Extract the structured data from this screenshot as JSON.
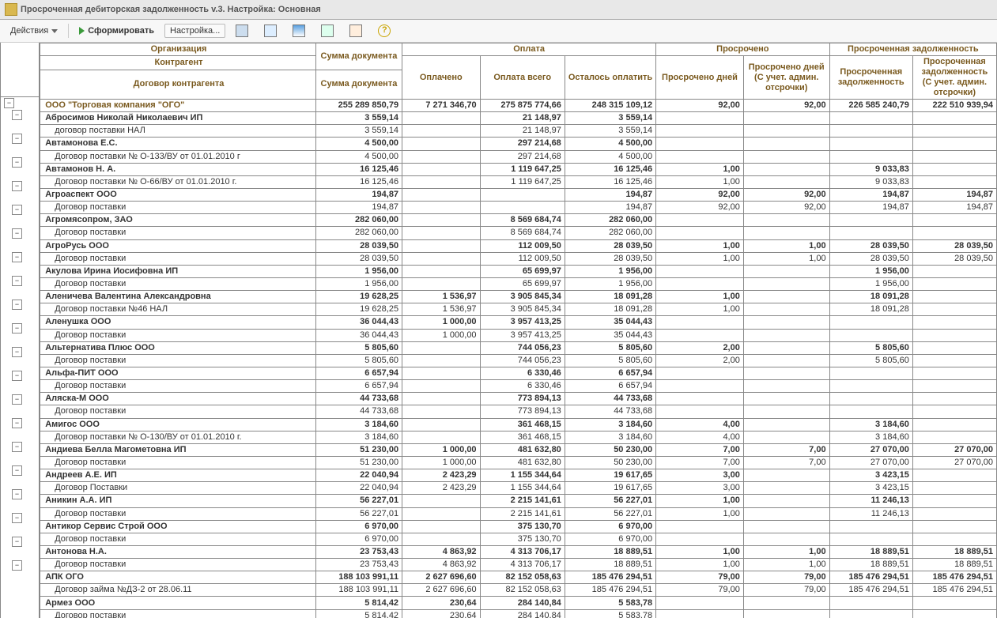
{
  "window_title": "Просроченная дебиторская задолженность v.3. Настройка: Основная",
  "toolbar": {
    "actions": "Действия",
    "form": "Сформировать",
    "settings": "Настройка..."
  },
  "header": {
    "org": "Организация",
    "kagent": "Контрагент",
    "dogovor": "Договор контрагента",
    "sum_doc": "Сумма документа",
    "oplata": "Оплата",
    "oplacheno": "Оплачено",
    "oplata_vsego": "Оплата всего",
    "ost_oplat": "Осталось оплатить",
    "prosr": "Просрочено",
    "prosr_dnei": "Просрочено дней",
    "prosr_dnei_adm": "Просрочено дней (С учет. админ. отсрочки)",
    "zadolz": "Просроченная задолженность",
    "z1": "Просроченная задолженность",
    "z2": "Просроченная задолженность (С учет. админ. отсрочки)"
  },
  "rows": [
    {
      "lvl": 0,
      "exp": "-",
      "name": "ООО \"Торговая компания \"ОГО\"",
      "c": [
        "255 289 850,79",
        "7 271 346,70",
        "275 875 774,66",
        "248 315 109,12",
        "92,00",
        "92,00",
        "226 585 240,79",
        "222 510 939,94"
      ]
    },
    {
      "lvl": 1,
      "exp": "-",
      "name": "Абросимов Николай Николаевич ИП",
      "c": [
        "3 559,14",
        "",
        "21 148,97",
        "3 559,14",
        "",
        "",
        "",
        ""
      ]
    },
    {
      "lvl": 2,
      "name": "договор поставки НАЛ",
      "c": [
        "3 559,14",
        "",
        "21 148,97",
        "3 559,14",
        "",
        "",
        "",
        ""
      ]
    },
    {
      "lvl": 1,
      "exp": "-",
      "name": "Автамонова Е.С.",
      "c": [
        "4 500,00",
        "",
        "297 214,68",
        "4 500,00",
        "",
        "",
        "",
        ""
      ]
    },
    {
      "lvl": 2,
      "name": "Договор поставки № О-133/ВУ от 01.01.2010 г",
      "c": [
        "4 500,00",
        "",
        "297 214,68",
        "4 500,00",
        "",
        "",
        "",
        ""
      ]
    },
    {
      "lvl": 1,
      "exp": "-",
      "name": "Автамонов Н. А.",
      "c": [
        "16 125,46",
        "",
        "1 119 647,25",
        "16 125,46",
        "1,00",
        "",
        "9 033,83",
        ""
      ]
    },
    {
      "lvl": 2,
      "name": "Договор поставки № О-66/ВУ от 01.01.2010 г.",
      "c": [
        "16 125,46",
        "",
        "1 119 647,25",
        "16 125,46",
        "1,00",
        "",
        "9 033,83",
        ""
      ]
    },
    {
      "lvl": 1,
      "exp": "-",
      "name": "Агроаспект ООО",
      "c": [
        "194,87",
        "",
        "",
        "194,87",
        "92,00",
        "92,00",
        "194,87",
        "194,87"
      ]
    },
    {
      "lvl": 2,
      "name": "Договор поставки",
      "c": [
        "194,87",
        "",
        "",
        "194,87",
        "92,00",
        "92,00",
        "194,87",
        "194,87"
      ]
    },
    {
      "lvl": 1,
      "exp": "-",
      "name": "Агромясопром, ЗАО",
      "c": [
        "282 060,00",
        "",
        "8 569 684,74",
        "282 060,00",
        "",
        "",
        "",
        ""
      ]
    },
    {
      "lvl": 2,
      "name": "Договор поставки",
      "c": [
        "282 060,00",
        "",
        "8 569 684,74",
        "282 060,00",
        "",
        "",
        "",
        ""
      ]
    },
    {
      "lvl": 1,
      "exp": "-",
      "name": "АгроРусь ООО",
      "c": [
        "28 039,50",
        "",
        "112 009,50",
        "28 039,50",
        "1,00",
        "1,00",
        "28 039,50",
        "28 039,50"
      ]
    },
    {
      "lvl": 2,
      "name": "Договор поставки",
      "c": [
        "28 039,50",
        "",
        "112 009,50",
        "28 039,50",
        "1,00",
        "1,00",
        "28 039,50",
        "28 039,50"
      ]
    },
    {
      "lvl": 1,
      "exp": "-",
      "name": "Акулова Ирина Иосифовна ИП",
      "c": [
        "1 956,00",
        "",
        "65 699,97",
        "1 956,00",
        "",
        "",
        "1 956,00",
        ""
      ]
    },
    {
      "lvl": 2,
      "name": "Договор поставки",
      "c": [
        "1 956,00",
        "",
        "65 699,97",
        "1 956,00",
        "",
        "",
        "1 956,00",
        ""
      ]
    },
    {
      "lvl": 1,
      "exp": "-",
      "name": "Аленичева Валентина Александровна",
      "c": [
        "19 628,25",
        "1 536,97",
        "3 905 845,34",
        "18 091,28",
        "1,00",
        "",
        "18 091,28",
        ""
      ]
    },
    {
      "lvl": 2,
      "name": "Договор поставки №46 НАЛ",
      "c": [
        "19 628,25",
        "1 536,97",
        "3 905 845,34",
        "18 091,28",
        "1,00",
        "",
        "18 091,28",
        ""
      ]
    },
    {
      "lvl": 1,
      "exp": "-",
      "name": "Аленушка ООО",
      "c": [
        "36 044,43",
        "1 000,00",
        "3 957 413,25",
        "35 044,43",
        "",
        "",
        "",
        ""
      ]
    },
    {
      "lvl": 2,
      "name": "Договор поставки",
      "c": [
        "36 044,43",
        "1 000,00",
        "3 957 413,25",
        "35 044,43",
        "",
        "",
        "",
        ""
      ]
    },
    {
      "lvl": 1,
      "exp": "-",
      "name": "Альтернатива Плюс ООО",
      "c": [
        "5 805,60",
        "",
        "744 056,23",
        "5 805,60",
        "2,00",
        "",
        "5 805,60",
        ""
      ]
    },
    {
      "lvl": 2,
      "name": "Договор поставки",
      "c": [
        "5 805,60",
        "",
        "744 056,23",
        "5 805,60",
        "2,00",
        "",
        "5 805,60",
        ""
      ]
    },
    {
      "lvl": 1,
      "exp": "-",
      "name": "Альфа-ПИТ ООО",
      "c": [
        "6 657,94",
        "",
        "6 330,46",
        "6 657,94",
        "",
        "",
        "",
        ""
      ]
    },
    {
      "lvl": 2,
      "name": "Договор поставки",
      "c": [
        "6 657,94",
        "",
        "6 330,46",
        "6 657,94",
        "",
        "",
        "",
        ""
      ]
    },
    {
      "lvl": 1,
      "exp": "-",
      "name": "Аляска-М ООО",
      "c": [
        "44 733,68",
        "",
        "773 894,13",
        "44 733,68",
        "",
        "",
        "",
        ""
      ]
    },
    {
      "lvl": 2,
      "name": "Договор поставки",
      "c": [
        "44 733,68",
        "",
        "773 894,13",
        "44 733,68",
        "",
        "",
        "",
        ""
      ]
    },
    {
      "lvl": 1,
      "exp": "-",
      "name": "Амигос ООО",
      "c": [
        "3 184,60",
        "",
        "361 468,15",
        "3 184,60",
        "4,00",
        "",
        "3 184,60",
        ""
      ]
    },
    {
      "lvl": 2,
      "name": "Договор поставки № О-130/ВУ от 01.01.2010 г.",
      "c": [
        "3 184,60",
        "",
        "361 468,15",
        "3 184,60",
        "4,00",
        "",
        "3 184,60",
        ""
      ]
    },
    {
      "lvl": 1,
      "exp": "-",
      "name": "Андиева Белла Магометовна ИП",
      "c": [
        "51 230,00",
        "1 000,00",
        "481 632,80",
        "50 230,00",
        "7,00",
        "7,00",
        "27 070,00",
        "27 070,00"
      ]
    },
    {
      "lvl": 2,
      "name": "Договор поставки",
      "c": [
        "51 230,00",
        "1 000,00",
        "481 632,80",
        "50 230,00",
        "7,00",
        "7,00",
        "27 070,00",
        "27 070,00"
      ]
    },
    {
      "lvl": 1,
      "exp": "-",
      "name": "Андреев А.Е. ИП",
      "c": [
        "22 040,94",
        "2 423,29",
        "1 155 344,64",
        "19 617,65",
        "3,00",
        "",
        "3 423,15",
        ""
      ]
    },
    {
      "lvl": 2,
      "name": "Договор Поставки",
      "c": [
        "22 040,94",
        "2 423,29",
        "1 155 344,64",
        "19 617,65",
        "3,00",
        "",
        "3 423,15",
        ""
      ]
    },
    {
      "lvl": 1,
      "exp": "-",
      "name": "Аникин А.А. ИП",
      "c": [
        "56 227,01",
        "",
        "2 215 141,61",
        "56 227,01",
        "1,00",
        "",
        "11 246,13",
        ""
      ]
    },
    {
      "lvl": 2,
      "name": "Договор поставки",
      "c": [
        "56 227,01",
        "",
        "2 215 141,61",
        "56 227,01",
        "1,00",
        "",
        "11 246,13",
        ""
      ]
    },
    {
      "lvl": 1,
      "exp": "-",
      "name": "Антикор Сервис Строй ООО",
      "c": [
        "6 970,00",
        "",
        "375 130,70",
        "6 970,00",
        "",
        "",
        "",
        ""
      ]
    },
    {
      "lvl": 2,
      "name": "Договор поставки",
      "c": [
        "6 970,00",
        "",
        "375 130,70",
        "6 970,00",
        "",
        "",
        "",
        ""
      ]
    },
    {
      "lvl": 1,
      "exp": "-",
      "name": "Антонова Н.А.",
      "c": [
        "23 753,43",
        "4 863,92",
        "4 313 706,17",
        "18 889,51",
        "1,00",
        "1,00",
        "18 889,51",
        "18 889,51"
      ]
    },
    {
      "lvl": 2,
      "name": "Договор поставки",
      "c": [
        "23 753,43",
        "4 863,92",
        "4 313 706,17",
        "18 889,51",
        "1,00",
        "1,00",
        "18 889,51",
        "18 889,51"
      ]
    },
    {
      "lvl": 1,
      "exp": "-",
      "name": "АПК ОГО",
      "c": [
        "188 103 991,11",
        "2 627 696,60",
        "82 152 058,63",
        "185 476 294,51",
        "79,00",
        "79,00",
        "185 476 294,51",
        "185 476 294,51"
      ]
    },
    {
      "lvl": 2,
      "name": "Договор займа №ДЗ-2 от 28.06.11",
      "c": [
        "188 103 991,11",
        "2 627 696,60",
        "82 152 058,63",
        "185 476 294,51",
        "79,00",
        "79,00",
        "185 476 294,51",
        "185 476 294,51"
      ]
    },
    {
      "lvl": 1,
      "exp": "-",
      "name": "Армез ООО",
      "c": [
        "5 814,42",
        "230,64",
        "284 140,84",
        "5 583,78",
        "",
        "",
        "",
        ""
      ]
    },
    {
      "lvl": 2,
      "name": "Договор поставки",
      "c": [
        "5 814,42",
        "230,64",
        "284 140,84",
        "5 583,78",
        "",
        "",
        "",
        ""
      ]
    }
  ]
}
